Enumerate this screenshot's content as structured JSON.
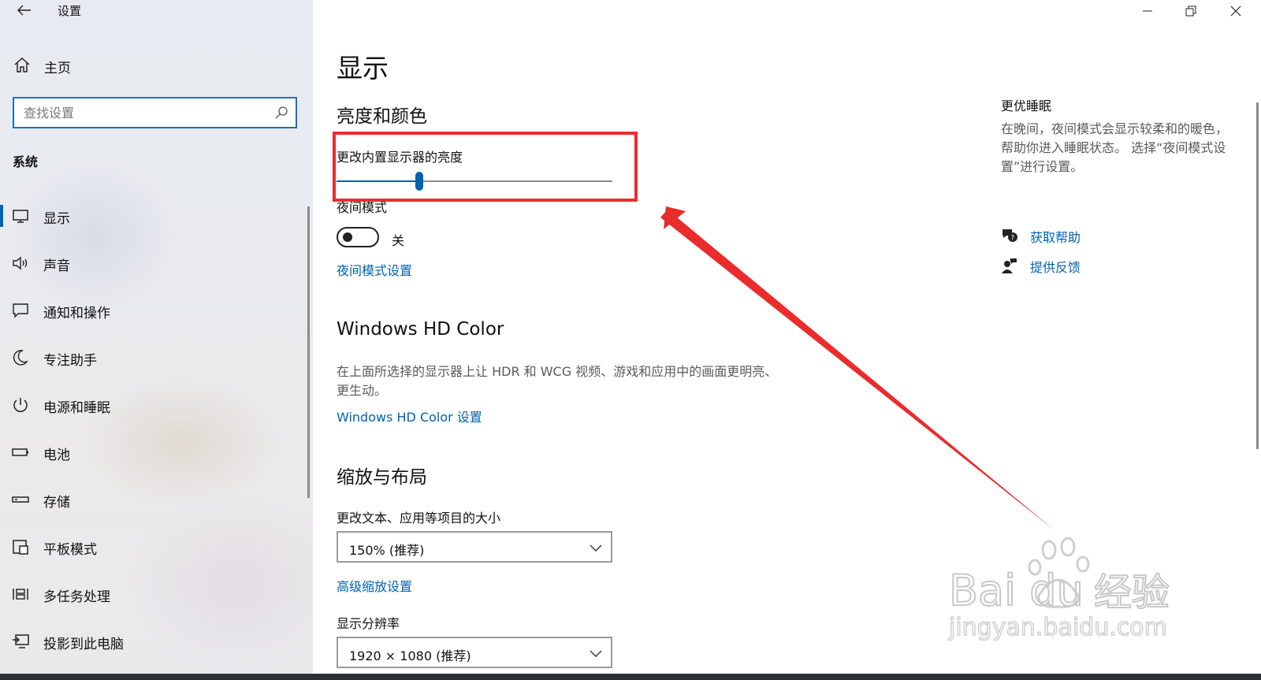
{
  "app": {
    "title": "设置"
  },
  "sidebar": {
    "home_label": "主页",
    "search_placeholder": "查找设置",
    "section_title": "系统",
    "items": [
      {
        "label": "显示",
        "icon": "monitor-icon"
      },
      {
        "label": "声音",
        "icon": "speaker-icon"
      },
      {
        "label": "通知和操作",
        "icon": "notification-icon"
      },
      {
        "label": "专注助手",
        "icon": "moon-icon"
      },
      {
        "label": "电源和睡眠",
        "icon": "power-icon"
      },
      {
        "label": "电池",
        "icon": "battery-icon"
      },
      {
        "label": "存储",
        "icon": "storage-icon"
      },
      {
        "label": "平板模式",
        "icon": "tablet-icon"
      },
      {
        "label": "多任务处理",
        "icon": "multitask-icon"
      },
      {
        "label": "投影到此电脑",
        "icon": "project-icon"
      }
    ]
  },
  "main": {
    "page_title": "显示",
    "brightness": {
      "heading": "亮度和颜色",
      "slider_label": "更改内置显示器的亮度",
      "slider_value_fraction": 0.3
    },
    "night_light": {
      "label": "夜间模式",
      "toggle_state": "关",
      "settings_link": "夜间模式设置"
    },
    "hdr": {
      "heading": "Windows HD Color",
      "description": "在上面所选择的显示器上让 HDR 和 WCG 视频、游戏和应用中的画面更明亮、更生动。",
      "link": "Windows HD Color 设置"
    },
    "scale": {
      "heading": "缩放与布局",
      "text_size_label": "更改文本、应用等项目的大小",
      "text_size_value": "150% (推荐)",
      "advanced_link": "高级缩放设置",
      "resolution_label": "显示分辨率",
      "resolution_value": "1920 × 1080 (推荐)"
    }
  },
  "right_panel": {
    "title": "更优睡眠",
    "description": "在晚间，夜间模式会显示较柔和的暖色，帮助你进入睡眠状态。 选择“夜间模式设置”进行设置。",
    "get_help": "获取帮助",
    "feedback": "提供反馈"
  },
  "watermark": {
    "brand": "Bai du",
    "brand_cn": "经验",
    "url": "jingyan.baidu.com"
  },
  "colors": {
    "accent": "#0063b1",
    "annotation": "#ea2c2c"
  }
}
